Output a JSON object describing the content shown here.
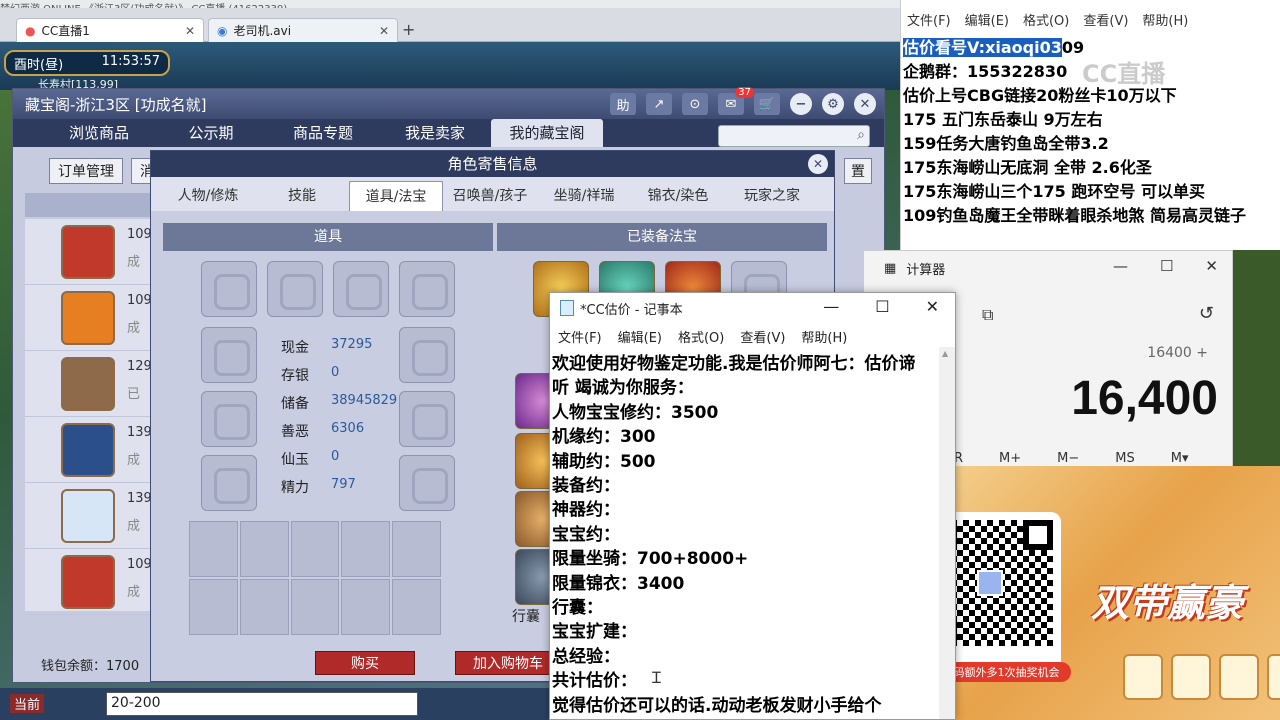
{
  "browser": {
    "top_text": "梦幻西游 ONLINE   《浙江3区(功成名就)》   CC直播   (41622339)",
    "tabs": [
      {
        "label": "CC直播1",
        "active": true
      },
      {
        "label": "老司机.avi",
        "active": false
      }
    ]
  },
  "game": {
    "clock_label": "酉时(昼)",
    "clock_time": "11:53:57",
    "location": "长寿村[113,99]",
    "chat_prefix": "当前",
    "chat_input": "20-200"
  },
  "cbg": {
    "title": "藏宝阁-浙江3区 [功成名就]",
    "title_buttons": [
      "助",
      "↗",
      "⊙"
    ],
    "message_badge": "37",
    "nav": [
      "浏览商品",
      "公示期",
      "商品专题",
      "我是卖家",
      "我的藏宝阁"
    ],
    "active_nav": 4,
    "sub_buttons": [
      "订单管理",
      "消"
    ],
    "setup_label": "置",
    "roles": [
      {
        "level": "109",
        "status": "成",
        "color": "#c0392b"
      },
      {
        "level": "109",
        "status": "成",
        "color": "#e67e22"
      },
      {
        "level": "129",
        "status": "已",
        "color": "#8e6a4a"
      },
      {
        "level": "139",
        "status": "成",
        "color": "#2a4f8a"
      },
      {
        "level": "139",
        "status": "成",
        "color": "#d6e6f6"
      },
      {
        "level": "109",
        "status": "成",
        "color": "#c0392b"
      }
    ],
    "wallet": "钱包余额：1700"
  },
  "info": {
    "title": "角色寄售信息",
    "tabs": [
      "人物/修炼",
      "技能",
      "道具/法宝",
      "召唤兽/孩子",
      "坐骑/祥瑞",
      "锦衣/染色",
      "玩家之家"
    ],
    "active_tab": 2,
    "items_header": "道具",
    "equipped_header": "已装备法宝",
    "stats": [
      {
        "k": "现金",
        "v": "37295"
      },
      {
        "k": "存银",
        "v": "0"
      },
      {
        "k": "储备",
        "v": "38945829"
      },
      {
        "k": "善恶",
        "v": "6306"
      },
      {
        "k": "仙玉",
        "v": "0"
      },
      {
        "k": "精力",
        "v": "797"
      }
    ],
    "buy_label": "购买",
    "cart_label": "加入购物车",
    "bag_label": "行囊"
  },
  "notepad_top": {
    "menu": [
      "文件(F)",
      "编辑(E)",
      "格式(O)",
      "查看(V)",
      "帮助(H)"
    ],
    "highlight": "估价看号V:xiaoqi03",
    "highlight_rest": "09",
    "lines": [
      "企鹅群：155322830",
      "估价上号CBG链接20粉丝卡10万以下",
      "175 五门东岳泰山  9万左右",
      "159任务大唐钓鱼岛全带3.2",
      "175东海崂山无底洞  全带   2.6化圣",
      "175东海崂山三个175 跑环空号 可以单买",
      "109钓鱼岛魔王全带眯着眼杀地煞 简易高灵链子"
    ],
    "watermark": "CC直播"
  },
  "calculator": {
    "title": "计算器",
    "expression": "16400 +",
    "result": "16,400",
    "memory": [
      "R",
      "M+",
      "M−",
      "MS",
      "M▾"
    ]
  },
  "notepad": {
    "title": "*CC估价 - 记事本",
    "menu": [
      "文件(F)",
      "编辑(E)",
      "格式(O)",
      "查看(V)",
      "帮助(H)"
    ],
    "lines": [
      "欢迎使用好物鉴定功能.我是估价师阿七：估价谛",
      "听 竭诚为你服务：",
      "人物宝宝修约：3500",
      "机缘约：300",
      "辅助约：500",
      "装备约：",
      "神器约：",
      "宝宝约：",
      "限量坐骑：700+8000+",
      "限量锦衣：3400",
      "行囊：",
      "宝宝扩建：",
      "总经验：",
      "共计估价：",
      "觉得估价还可以的话.动动老板发财小手给个"
    ]
  },
  "ad": {
    "slogan": "双带赢豪",
    "caption": "扫码额外多1次抽奖机会"
  }
}
